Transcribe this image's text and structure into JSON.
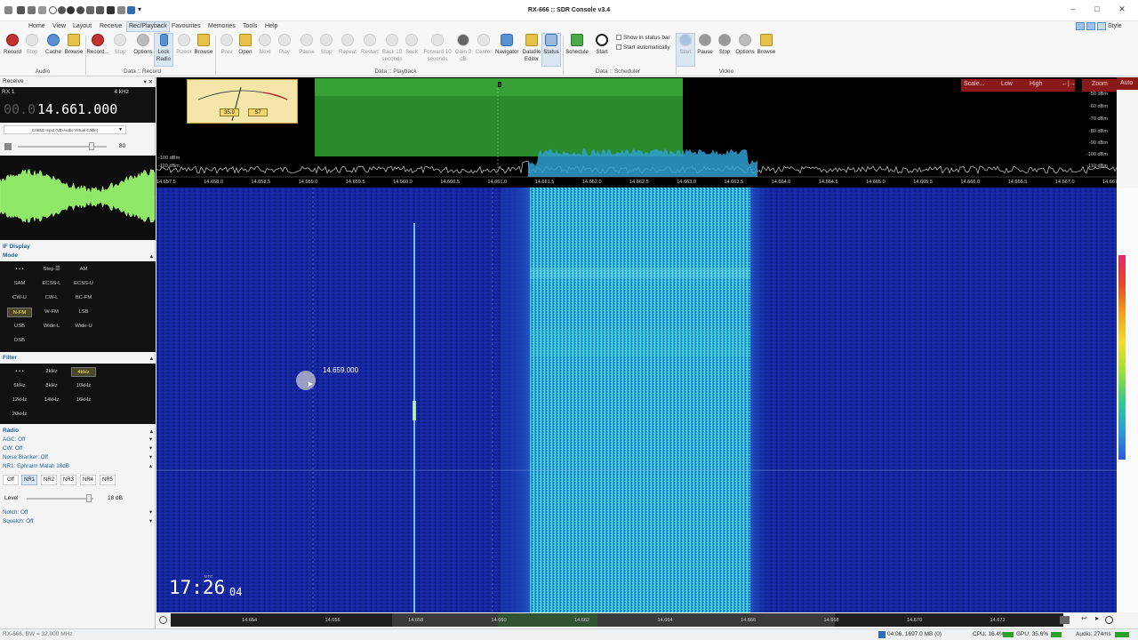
{
  "window": {
    "title": "RX-666 :: SDR Console v3.4",
    "style_label": "Style"
  },
  "menu": [
    "Home",
    "View",
    "Layout",
    "Receive",
    "Rec/Playback",
    "Favourites",
    "Memories",
    "Tools",
    "Help"
  ],
  "menu_active": "Rec/Playback",
  "ribbon": {
    "audio": [
      "Record",
      "Stop",
      "Cache",
      "Browse"
    ],
    "record": [
      "Record...",
      "Stop",
      "Options"
    ],
    "lock": "Lock\nRadio",
    "power": "Power",
    "browse": "Browse",
    "playback": [
      "Prev",
      "Open",
      "Next",
      "Play",
      "Pause",
      "Stop",
      "Repeat",
      "Restart",
      "Back 10\nseconds",
      "Seek",
      "Forward 10\nseconds",
      "Gain 0\ndB",
      "Center",
      "Navigator",
      "Datafile\nEditor",
      "Status"
    ],
    "scheduler": [
      "Schedule",
      "Start"
    ],
    "show_in_status_bar": "Show in status bar",
    "start_automatically": "Start automatically",
    "video": [
      "Start",
      "Pause",
      "Stop",
      "Options",
      "Browse"
    ],
    "groups": {
      "audio": "Audio",
      "record": "Data :: Record",
      "playback": "Data :: Playback",
      "scheduler": "Data :: Scheduler",
      "video": "Video"
    }
  },
  "left": {
    "receive_title": "Receive",
    "rx_label": "RX 1",
    "bandwidth": "4 kHz",
    "freq_dim": "00.0",
    "frequency": "14.661.000",
    "audio_device": "CABLE Input (VB-Audio Virtual Cable)",
    "volume": "80",
    "if_display": "IF Display",
    "mode_title": "Mode",
    "modes": [
      "• • •",
      "Step ☰",
      "AM",
      "SAM",
      "ECSS-L",
      "ECSS-U",
      "CW-U",
      "CW-L",
      "BC-FM",
      "N-FM",
      "W-FM",
      "LSB",
      "USB",
      "Wide-L",
      "Wide-U",
      "DSB"
    ],
    "mode_selected": "N-FM",
    "filter_title": "Filter",
    "filters": [
      "• • •",
      "2kHz",
      "4kHz",
      "6kHz",
      "8kHz",
      "10kHz",
      "12kHz",
      "14kHz",
      "16kHz",
      "20kHz"
    ],
    "filter_selected": "4kHz",
    "radio_title": "Radio",
    "agc": "AGC: Off",
    "cw": "CW: Off",
    "noise_blanker": "Noise Blanker: Off",
    "nr1": "NR1: Ephraim Malah 18dB",
    "nr_buttons": [
      "Off",
      "NR1",
      "NR2",
      "NR3",
      "NR4",
      "NR5"
    ],
    "nr_selected": "NR1",
    "level_label": "Level",
    "level_value": "18 dB",
    "notch": "Notch: Off",
    "squelch": "Squelch: Off"
  },
  "meter": {
    "value": "35.9",
    "s_unit": "S7"
  },
  "spectrum": {
    "buttons": [
      "Scale...",
      "Low",
      "High"
    ],
    "zoom": "Zoom",
    "auto": "Auto",
    "db_labels": [
      "-50 dBm",
      "-60 dBm",
      "-70 dBm",
      "-80 dBm",
      "-90 dBm",
      "-100 dBm",
      "-110 dBm"
    ],
    "freq_ticks": [
      "14.657.5",
      "14.658.0",
      "14.658.5",
      "14.659.0",
      "14.659.5",
      "14.660.0",
      "14.660.5",
      "14.661.0",
      "14.661.5",
      "14.662.0",
      "14.662.5",
      "14.663.0",
      "14.663.5",
      "14.664.0",
      "14.664.5",
      "14.665.0",
      "14.665.5",
      "14.666.0",
      "14.666.5",
      "14.667.0",
      "14.667.5"
    ]
  },
  "waterfall": {
    "cursor_freq": "14.659.000",
    "time": "17:26",
    "time_sec": "04",
    "time_tz": "UTC"
  },
  "scale_ticks": [
    "14.654",
    "14.656",
    "14.658",
    "14.660",
    "14.662",
    "14.664",
    "14.666",
    "14.668",
    "14.670",
    "14.672"
  ],
  "status": {
    "left": "RX-666, BW = 32.000 MHz",
    "disk": "04:06, 1697.0 MB (0)",
    "cpu": "CPU: 16.4%",
    "gpu": "GPU: 35.6%",
    "audio": "Audio: 274ms"
  },
  "colors": {
    "waterfall_bg": "#111f8c",
    "signal_cyan": "#3fd0e0",
    "spectrum_green": "#2e9a2e",
    "accent_blue": "#1f5fa8"
  }
}
